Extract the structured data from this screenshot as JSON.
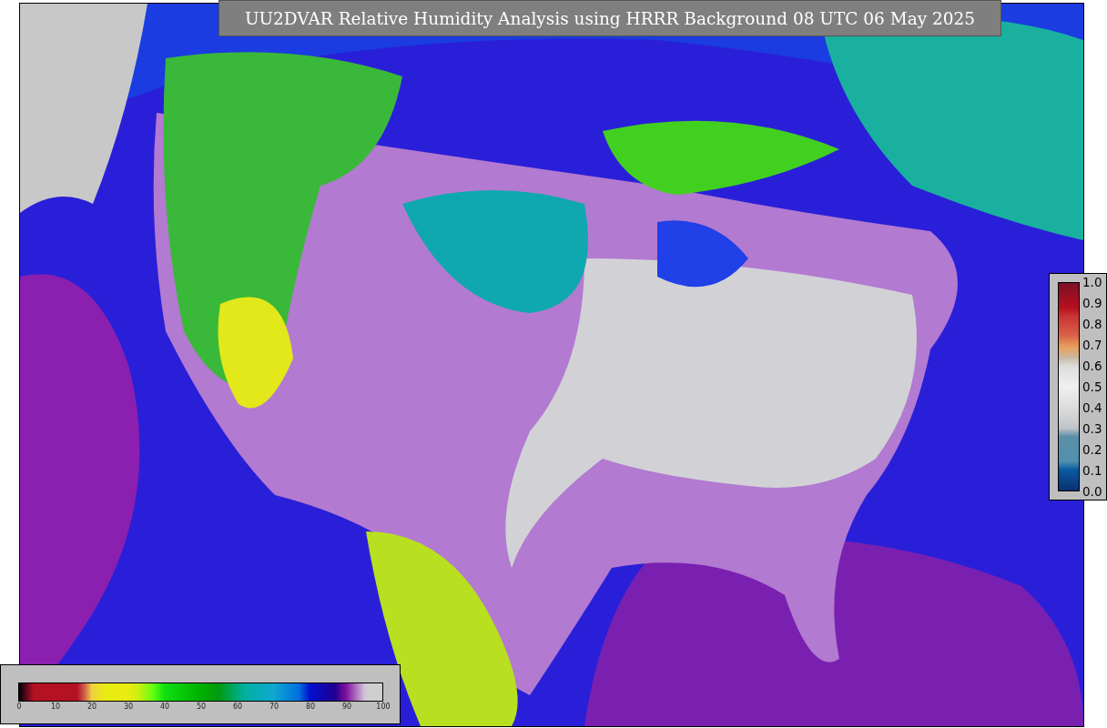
{
  "title": "UU2DVAR Relative Humidity Analysis using HRRR Background 08 UTC 06 May 2025",
  "side_colorbar": {
    "ticks": [
      "1.0",
      "0.9",
      "0.8",
      "0.7",
      "0.6",
      "0.5",
      "0.4",
      "0.3",
      "0.2",
      "0.1",
      "0.0"
    ]
  },
  "bottom_colorbar": {
    "ticks": [
      "0",
      "10",
      "20",
      "30",
      "40",
      "50",
      "60",
      "70",
      "80",
      "90",
      "100"
    ]
  }
}
